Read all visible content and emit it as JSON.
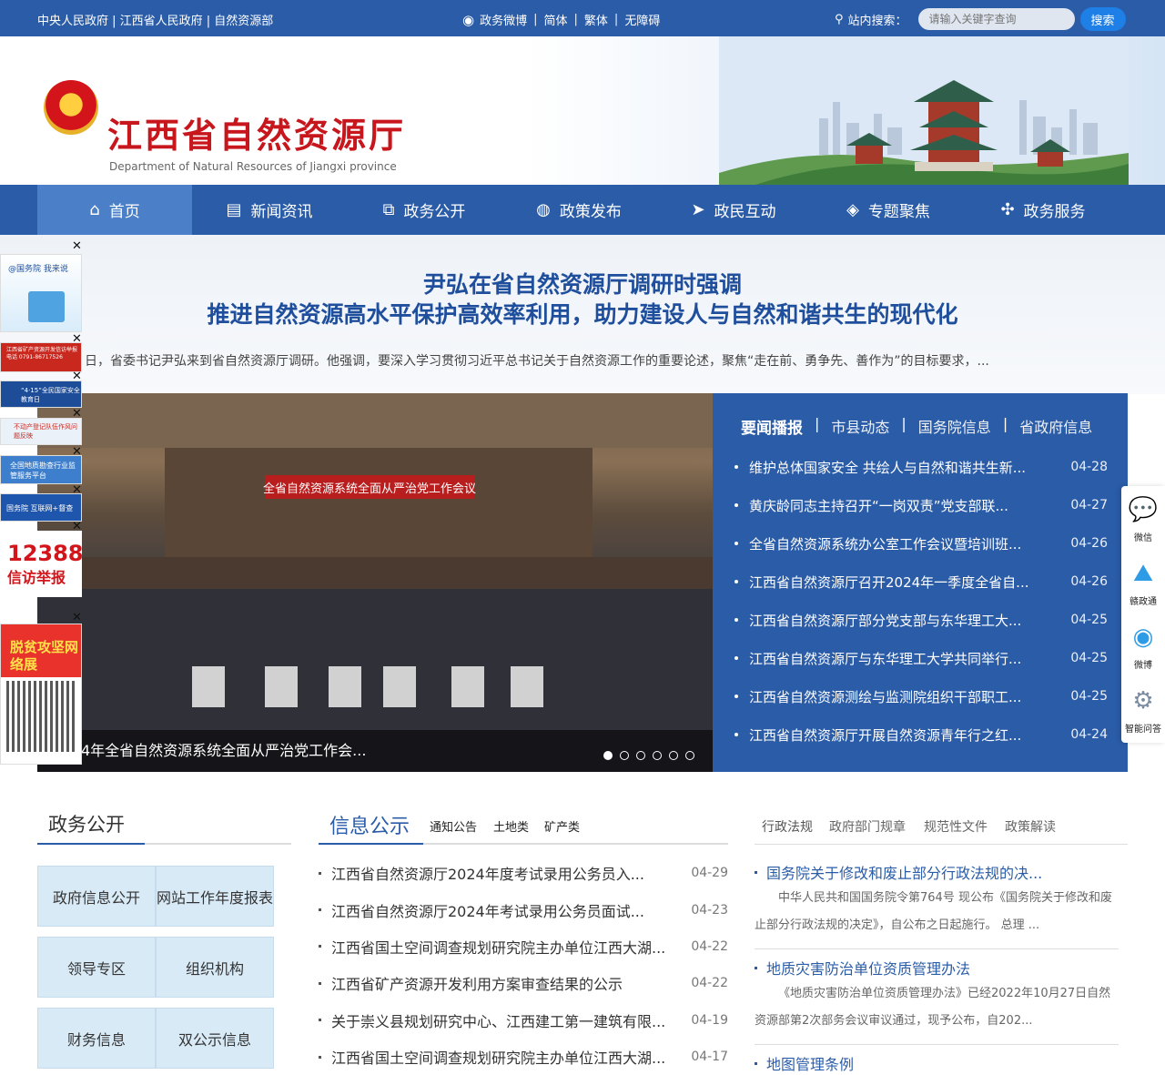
{
  "topbar": {
    "links": "中央人民政府 | 江西省人民政府 | 自然资源部",
    "weibo": "政务微博",
    "simplified": "简体",
    "traditional": "繁体",
    "accessible": "无障碍",
    "search_label": "站内搜索：",
    "search_placeholder": "请输入关键字查询",
    "search_button": "搜索"
  },
  "banner": {
    "title": "江西省自然资源厅",
    "subtitle": "Department of Natural Resources of Jiangxi province"
  },
  "nav": [
    {
      "label": "首页",
      "icon": "home-icon"
    },
    {
      "label": "新闻资讯",
      "icon": "news-icon"
    },
    {
      "label": "政务公开",
      "icon": "document-search-icon"
    },
    {
      "label": "政策发布",
      "icon": "chat-icon"
    },
    {
      "label": "政民互动",
      "icon": "send-icon"
    },
    {
      "label": "专题聚焦",
      "icon": "layers-icon"
    },
    {
      "label": "政务服务",
      "icon": "grid-icon"
    }
  ],
  "headline": {
    "line1": "尹弘在省自然资源厅调研时强调",
    "line2": "推进自然资源高水平保护高效率利用，助力建设人与自然和谐共生的现代化",
    "summary": "日，省委书记尹弘来到省自然资源厅调研。他强调，要深入学习贯彻习近平总书记关于自然资源工作的重要论述，聚焦“走在前、勇争先、善作为”的目标要求，..."
  },
  "left_ads": [
    {
      "text": "@国务院 我来说"
    },
    {
      "text": "江西省矿产资源开发信访举报电话 0791-86717526"
    },
    {
      "text": "“4·15”全民国家安全教育日"
    },
    {
      "text": "不动产登记队伍作风问题反映"
    },
    {
      "text": "全国地质勘查行业监管服务平台"
    },
    {
      "text": "国务院 互联网+督查"
    },
    {
      "text_top": "12388",
      "text_bottom": "信访举报"
    },
    {
      "text": "脱贫攻坚网络展"
    }
  ],
  "hero": {
    "banner_text": "全省自然资源系统全面从严治党工作会议",
    "caption": "4年全省自然资源系统全面从严治党工作会...",
    "dots_total": 6,
    "dots_active": 1
  },
  "news_panel": {
    "tabs": [
      "要闻播报",
      "市县动态",
      "国务院信息",
      "省政府信息"
    ],
    "items": [
      {
        "title": "维护总体国家安全 共绘人与自然和谐共生新...",
        "date": "04-28"
      },
      {
        "title": "黄庆龄同志主持召开“一岗双责”党支部联...",
        "date": "04-27"
      },
      {
        "title": "全省自然资源系统办公室工作会议暨培训班...",
        "date": "04-26"
      },
      {
        "title": "江西省自然资源厅召开2024年一季度全省自...",
        "date": "04-26"
      },
      {
        "title": "江西省自然资源厅部分党支部与东华理工大...",
        "date": "04-25"
      },
      {
        "title": "江西省自然资源厅与东华理工大学共同举行...",
        "date": "04-25"
      },
      {
        "title": "江西省自然资源测绘与监测院组织干部职工...",
        "date": "04-25"
      },
      {
        "title": "江西省自然资源厅开展自然资源青年行之红...",
        "date": "04-24"
      }
    ]
  },
  "side_icons": [
    {
      "label": "微信",
      "icon": "wechat-icon"
    },
    {
      "label": "赣政通",
      "icon": "ganzhengtong-icon"
    },
    {
      "label": "微博",
      "icon": "weibo-icon"
    },
    {
      "label": "智能问答",
      "icon": "robot-icon"
    }
  ],
  "zhengwu": {
    "title": "政务公开",
    "tiles": [
      "政府信息公开",
      "网站工作年度报表",
      "领导专区",
      "组织机构",
      "财务信息",
      "双公示信息"
    ]
  },
  "xinxi": {
    "title": "信息公示",
    "subtabs": [
      "通知公告",
      "土地类",
      "矿产类"
    ],
    "items": [
      {
        "title": "江西省自然资源厅2024年度考试录用公务员入...",
        "date": "04-29"
      },
      {
        "title": "江西省自然资源厅2024年考试录用公务员面试...",
        "date": "04-23"
      },
      {
        "title": "江西省国土空间调查规划研究院主办单位江西大湖...",
        "date": "04-22"
      },
      {
        "title": "江西省矿产资源开发利用方案审查结果的公示",
        "date": "04-22"
      },
      {
        "title": "关于崇义县规划研究中心、江西建工第一建筑有限...",
        "date": "04-19"
      },
      {
        "title": "江西省国土空间调查规划研究院主办单位江西大湖...",
        "date": "04-17"
      }
    ]
  },
  "policy": {
    "tabs": [
      "行政法规",
      "政府部门规章",
      "规范性文件",
      "政策解读"
    ],
    "items": [
      {
        "title": "国务院关于修改和废止部分行政法规的决...",
        "desc": "中华人民共和国国务院令第764号 现公布《国务院关于修改和废止部分行政法规的决定》，自公布之日起施行。 总理 ..."
      },
      {
        "title": "地质灾害防治单位资质管理办法",
        "desc": "《地质灾害防治单位资质管理办法》已经2022年10月27日自然资源部第2次部务会议审议通过，现予公布，自202..."
      },
      {
        "title": "地图管理条例",
        "desc": ""
      }
    ]
  }
}
